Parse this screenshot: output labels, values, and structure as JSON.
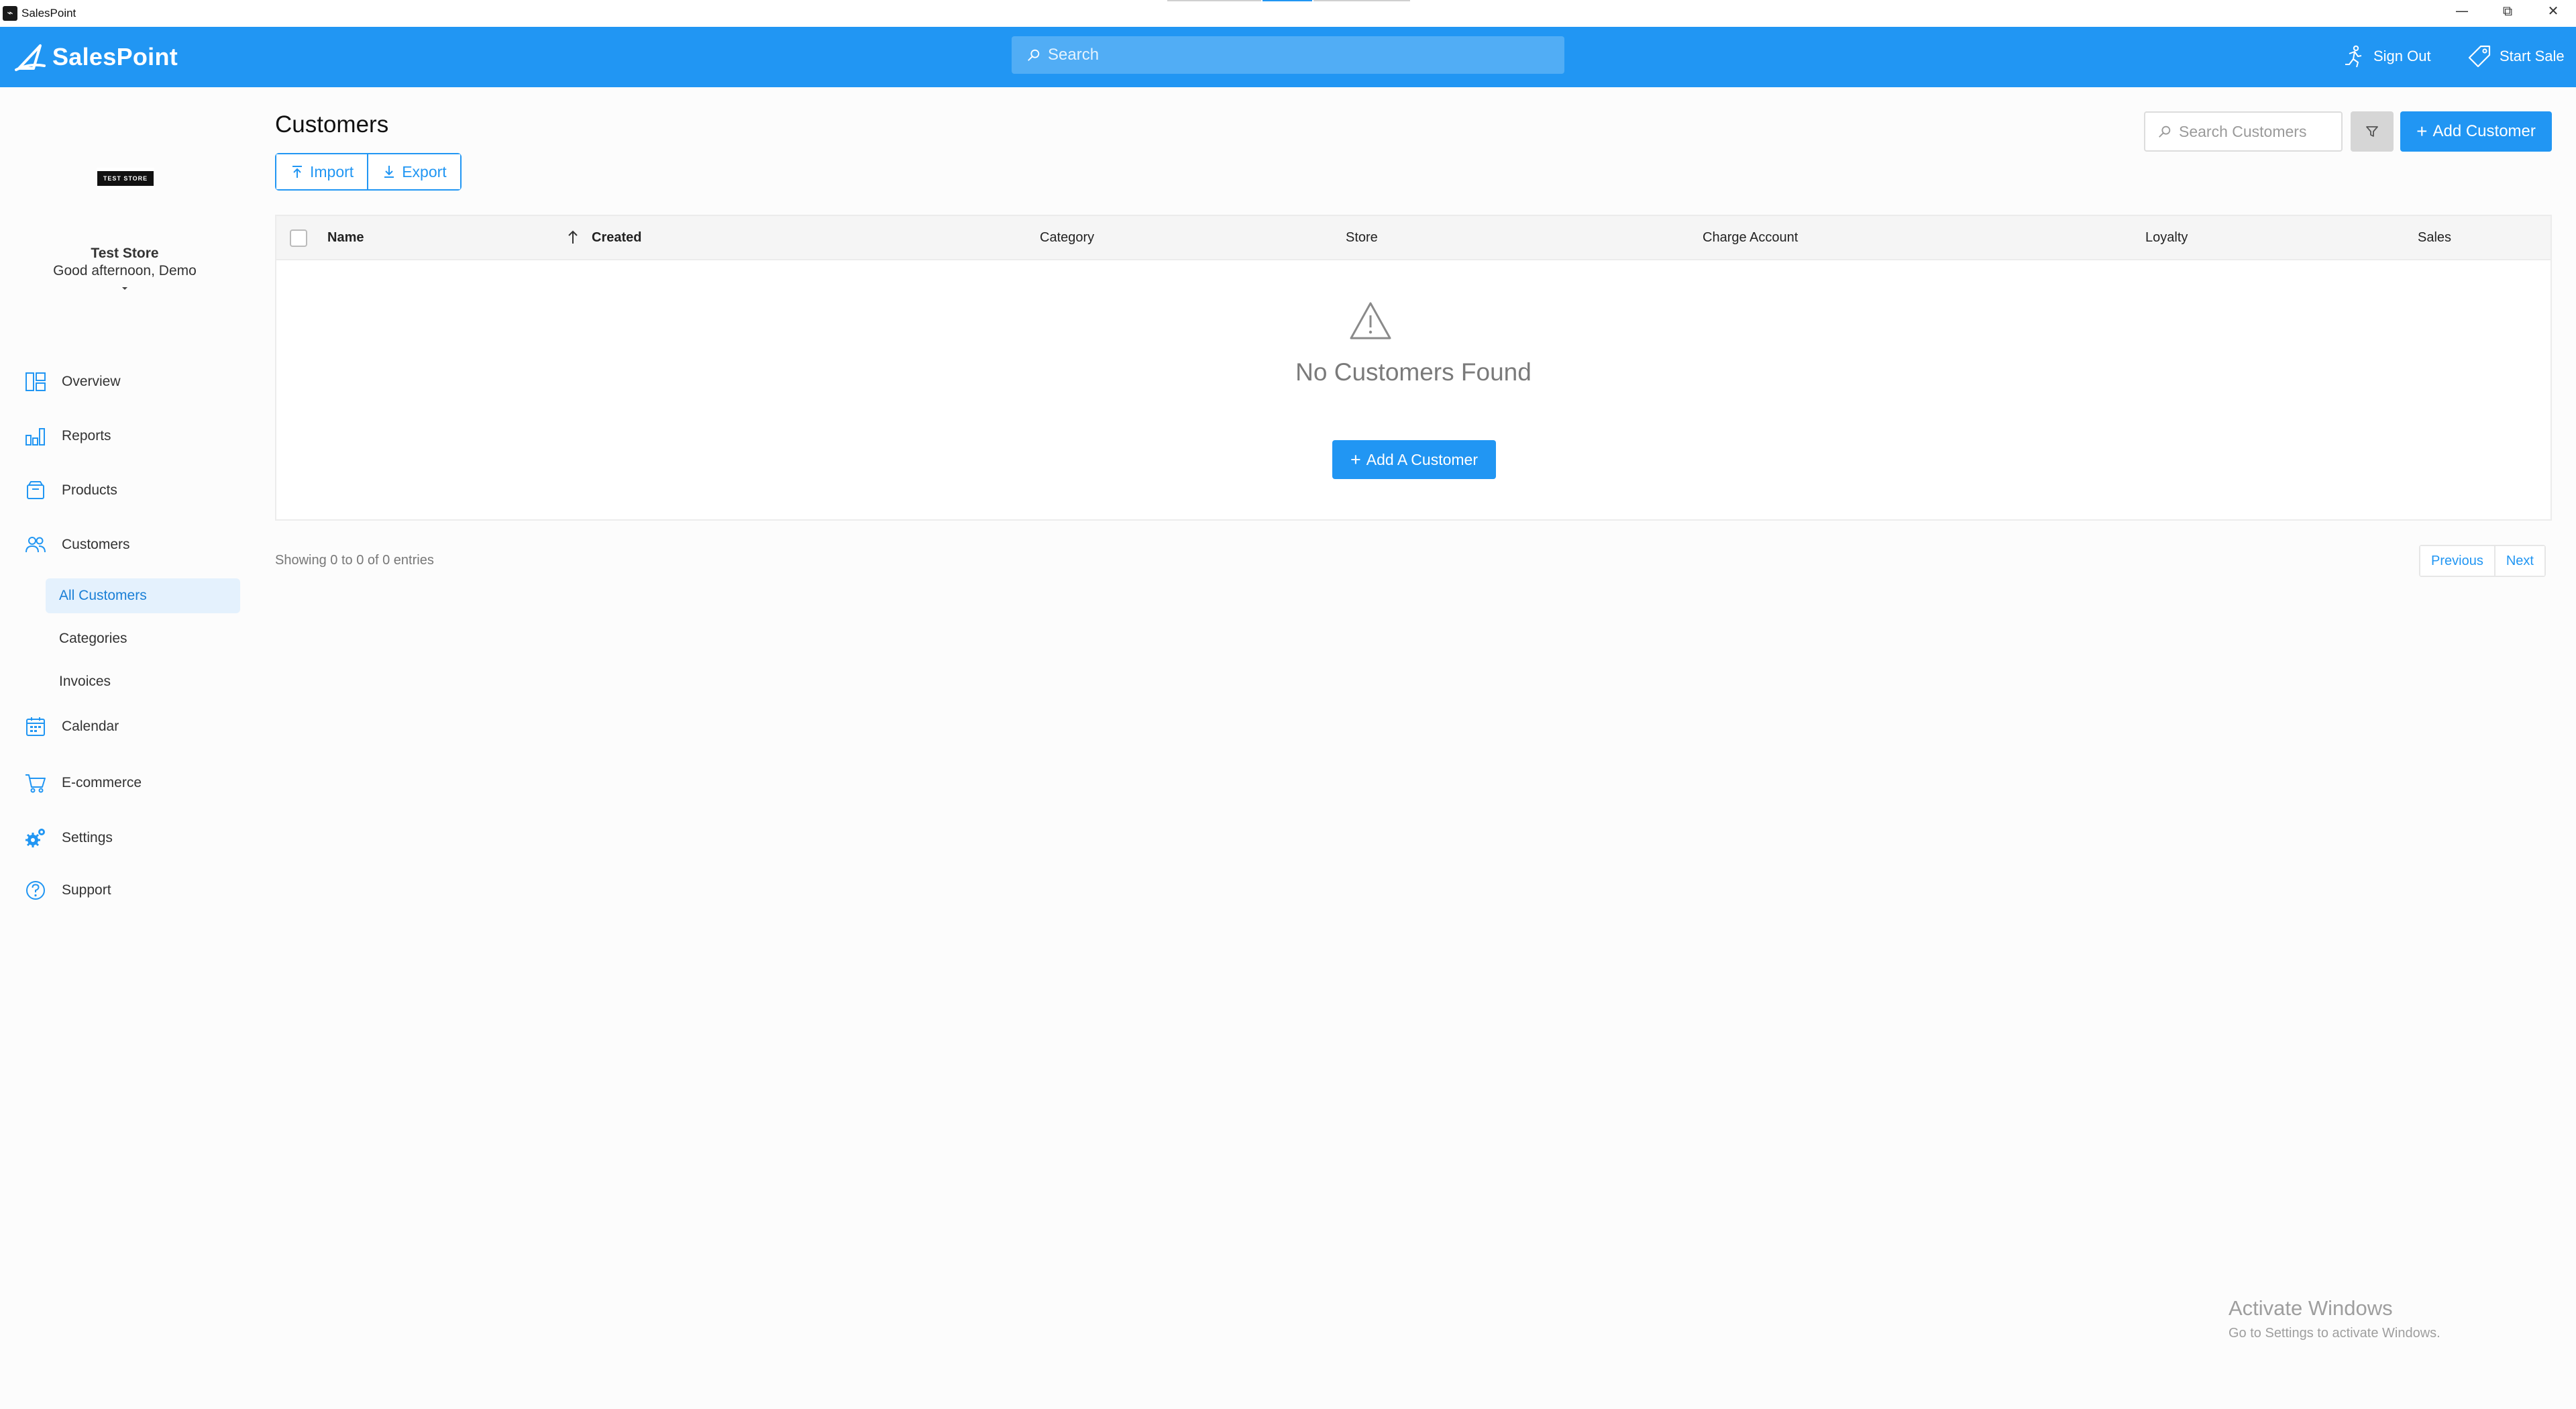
{
  "window": {
    "title": "SalesPoint",
    "app_icon": "salespoint-app-icon",
    "controls": {
      "minimize": "—",
      "restore": "⧉",
      "close": "✕"
    }
  },
  "topbar": {
    "brand": "SalesPoint",
    "search_placeholder": "Search",
    "sign_out": "Sign Out",
    "start_sale": "Start Sale",
    "color": "#2196f3"
  },
  "sidebar": {
    "logo_text": "TEST STORE",
    "store_name": "Test Store",
    "greeting": "Good afternoon, Demo",
    "items": [
      {
        "label": "Overview",
        "icon": "overview-icon"
      },
      {
        "label": "Reports",
        "icon": "bar-chart-icon"
      },
      {
        "label": "Products",
        "icon": "box-icon"
      },
      {
        "label": "Customers",
        "icon": "users-icon"
      },
      {
        "label": "Calendar",
        "icon": "calendar-icon"
      },
      {
        "label": "E-commerce",
        "icon": "cart-icon"
      },
      {
        "label": "Settings",
        "icon": "gear-icon"
      },
      {
        "label": "Support",
        "icon": "help-icon"
      }
    ],
    "customer_subitems": [
      {
        "label": "All Customers",
        "active": true
      },
      {
        "label": "Categories",
        "active": false
      },
      {
        "label": "Invoices",
        "active": false
      }
    ]
  },
  "main": {
    "title": "Customers",
    "import_label": "Import",
    "export_label": "Export",
    "search_placeholder": "Search Customers",
    "add_customer_label": "Add Customer",
    "table": {
      "columns": [
        "Name",
        "Created",
        "Category",
        "Store",
        "Charge Account",
        "Loyalty",
        "Sales"
      ],
      "rows": [],
      "empty_text": "No Customers Found",
      "empty_button": "Add A Customer"
    },
    "entries_text": "Showing 0 to 0 of 0 entries",
    "pagination": {
      "previous": "Previous",
      "next": "Next"
    }
  },
  "watermark": {
    "title": "Activate Windows",
    "subtitle": "Go to Settings to activate Windows."
  }
}
